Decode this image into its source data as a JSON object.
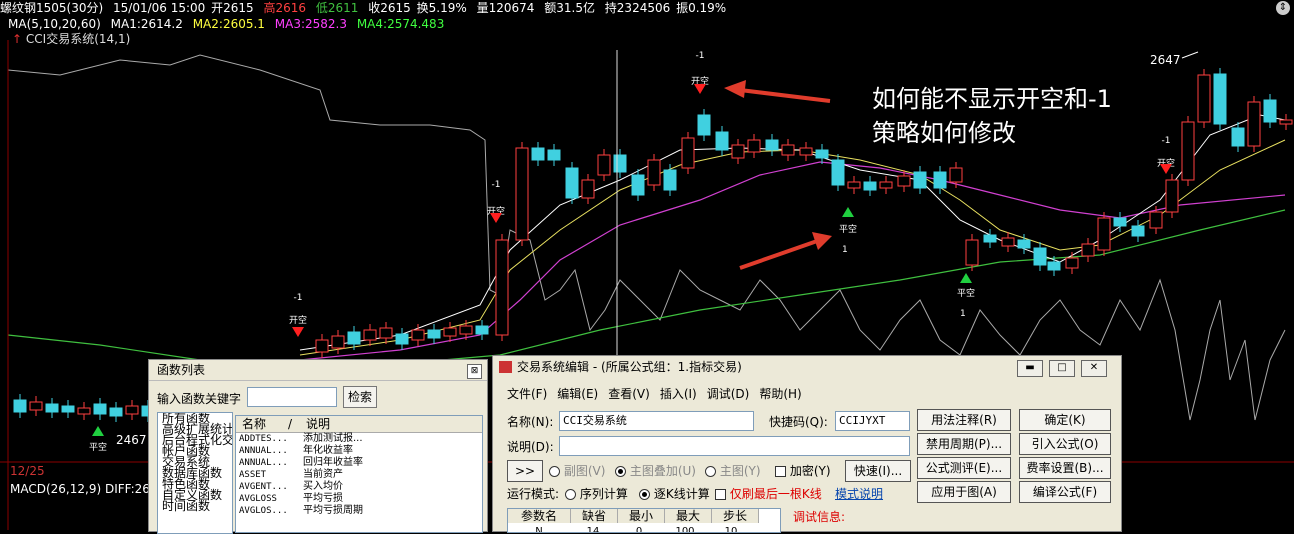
{
  "header": {
    "symbol": "螺纹钢1505",
    "period": "(30分)",
    "datetime": "15/01/06 15:00",
    "open": "开2615",
    "high": "高2616",
    "low": "低2611",
    "close": "收2615",
    "change": "换5.19%",
    "volume": "量120674",
    "amount": "额31.5亿",
    "holdings": "持2324506",
    "amplitude": "振0.19%"
  },
  "ma": {
    "title": "MA(5,10,20,60)",
    "ma1": "MA1:2614.2",
    "ma2": "MA2:2605.1",
    "ma3": "MA3:2582.3",
    "ma4": "MA4:2574.483"
  },
  "indicator": {
    "name": "CCI交易系统(14,1)"
  },
  "chart": {
    "signal_open": "开空",
    "signal_close": "平空",
    "value_neg": "-1",
    "value_pos": "1",
    "price_high": "2647",
    "price_low": "2467",
    "date_label": "12/25"
  },
  "annotation": {
    "line1": "如何能不显示开空和-1",
    "line2": "策略如何修改"
  },
  "macd": "MACD(26,12,9) DIFF:26.8",
  "function_list": {
    "title": "函数列表",
    "keyword_label": "输入函数关键字",
    "search_button": "检索",
    "categories": [
      "所有函数",
      "高级扩展统计",
      "后台程式化交",
      "帐户函数",
      "交易系统",
      "数据库函数",
      "特色函数",
      "自定义函数",
      "时间函数"
    ],
    "col_name": "名称",
    "col_desc": "说明",
    "rows": [
      {
        "name": "ADDTES...",
        "desc": "添加测试报..."
      },
      {
        "name": "ANNUAL...",
        "desc": "年化收益率"
      },
      {
        "name": "ANNUAL...",
        "desc": "回归年收益率"
      },
      {
        "name": "ASSET",
        "desc": "当前资产"
      },
      {
        "name": "AVGENT...",
        "desc": "买入均价"
      },
      {
        "name": "AVGLOSS",
        "desc": "平均亏损"
      },
      {
        "name": "AVGLOS...",
        "desc": "平均亏损周期"
      }
    ]
  },
  "editor": {
    "title": "交易系统编辑 - (所属公式组：1.指标交易)",
    "menu": [
      "文件(F)",
      "编辑(E)",
      "查看(V)",
      "插入(I)",
      "调试(D)",
      "帮助(H)"
    ],
    "name_label": "名称(N):",
    "name_value": "CCI交易系统",
    "shortcut_label": "快捷码(Q):",
    "shortcut_value": "CCIJYXT",
    "desc_label": "说明(D):",
    "desc_value": "",
    "expand_button": ">>",
    "subchart": "副图(V)",
    "main_overlay": "主图叠加(U)",
    "main_chart": "主图(Y)",
    "encrypt": "加密(Y)",
    "fast_button": "快速(I)...",
    "run_mode_label": "运行模式:",
    "seq_calc": "序列计算",
    "tick_calc": "逐K线计算",
    "last_bar_only": "仅刷最后一根K线",
    "mode_help": "模式说明",
    "buttons": {
      "usage_notes": "用法注释(R)",
      "confirm": "确定(K)",
      "disable_period": "禁用周期(P)...",
      "import": "引入公式(O)",
      "formula_test": "公式测评(E)...",
      "fee_settings": "费率设置(B)...",
      "apply_chart": "应用于图(A)",
      "compile": "编译公式(F)"
    },
    "params": {
      "headers": [
        "参数名",
        "缺省",
        "最小",
        "最大",
        "步长"
      ],
      "row1": [
        "N",
        "14",
        "0",
        "100",
        "10"
      ]
    },
    "debug_label": "调试信息:"
  }
}
